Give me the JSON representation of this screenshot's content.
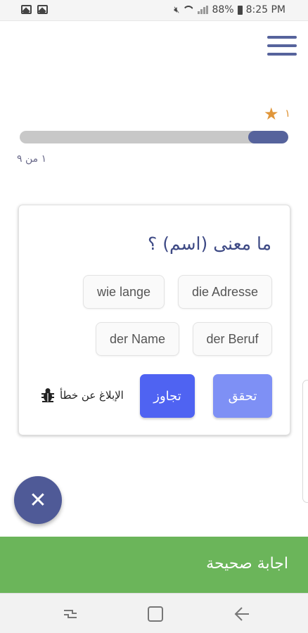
{
  "status_bar": {
    "battery": "88%",
    "time": "8:25 PM"
  },
  "header": {
    "menu_icon": "hamburger-icon"
  },
  "score": {
    "icon": "star-icon",
    "stars": "١"
  },
  "progress": {
    "fraction": 0.15,
    "text": "١ من ٩"
  },
  "quiz": {
    "question": "ما معنى (اسم) ؟",
    "options": [
      "die Adresse",
      "wie lange",
      "der Beruf",
      "der Name"
    ],
    "check_label": "تحقق",
    "skip_label": "تجاوز",
    "report_label": "الإبلاغ عن خطأ",
    "report_icon": "bug-icon"
  },
  "fab": {
    "icon": "close-icon"
  },
  "feedback": {
    "text": "اجابة صحيحة",
    "color": "#6bb55a"
  },
  "colors": {
    "accent": "#56639c",
    "check": "#7e90f5",
    "skip": "#4f63f2",
    "star": "#e0963a"
  }
}
